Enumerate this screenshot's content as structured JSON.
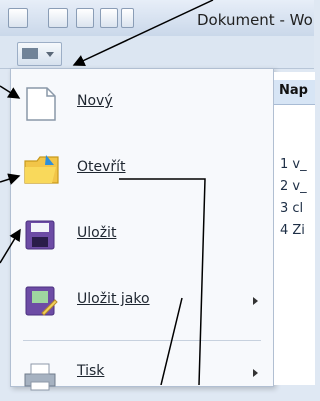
{
  "window": {
    "title": "Dokument - Wo"
  },
  "menu": {
    "items": [
      {
        "label": "Nový"
      },
      {
        "label": "Otevřít"
      },
      {
        "label": "Uložit"
      },
      {
        "label": "Uložit jako"
      },
      {
        "label": "Tisk"
      }
    ]
  },
  "recent": {
    "header": "Nap",
    "items": [
      "1 v_",
      "2 v_",
      "3 cl",
      "4 Zi"
    ]
  }
}
